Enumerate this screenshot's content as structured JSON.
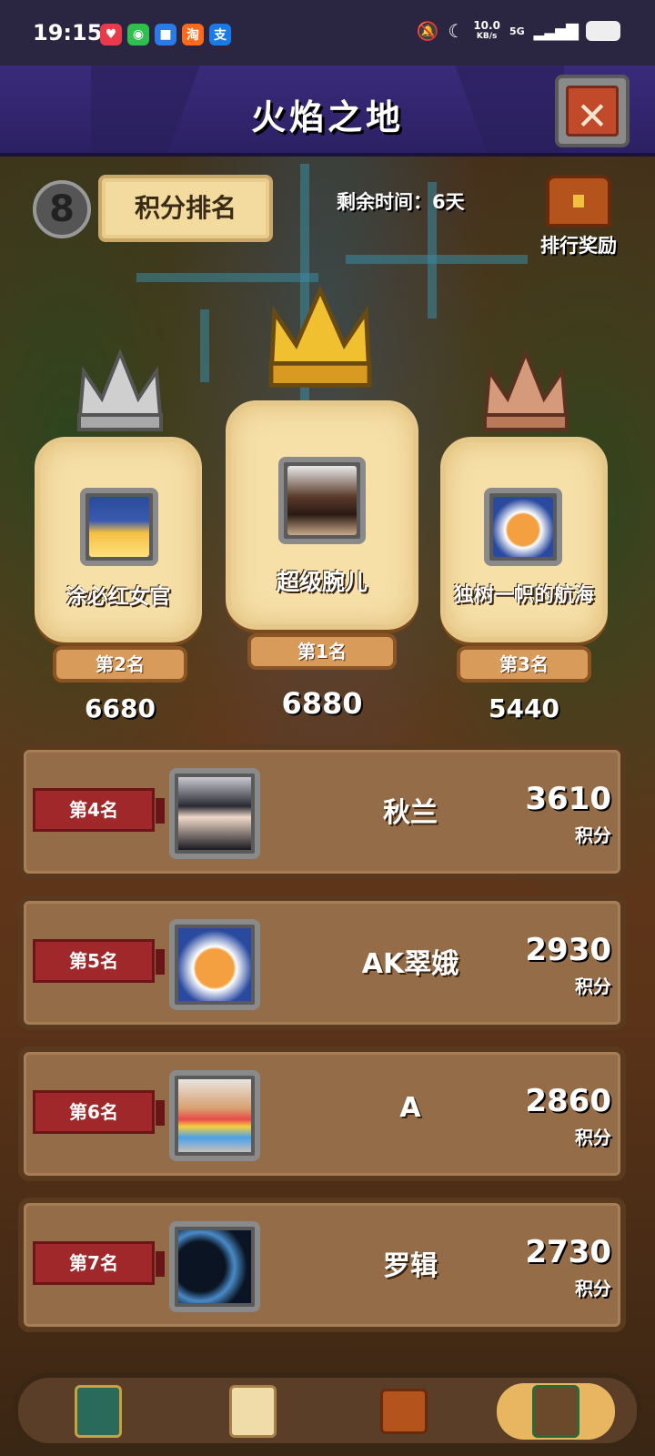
{
  "status_bar": {
    "time": "19:15",
    "speed_value": "10.0",
    "speed_unit": "KB/s",
    "network": "5G"
  },
  "header": {
    "title": "火焰之地",
    "close_icon": "close-icon"
  },
  "info": {
    "round": "8",
    "ranking_label": "积分排名",
    "remaining_time": "剩余时间：6天",
    "reward_label": "排行奖励"
  },
  "podium": {
    "first": {
      "name": "超级腕儿",
      "rank": "第1名",
      "score": "6880",
      "crown_color": "#e8b830"
    },
    "second": {
      "name": "涂必红女官",
      "rank": "第2名",
      "score": "6680",
      "crown_color": "#c8c8c8"
    },
    "third": {
      "name": "独树一帜的航海",
      "rank": "第3名",
      "score": "5440",
      "crown_color": "#c88a6a"
    }
  },
  "ranking_list": [
    {
      "rank": "第4名",
      "name": "秋兰",
      "score": "3610",
      "unit": "积分"
    },
    {
      "rank": "第5名",
      "name": "AK翠娥",
      "score": "2930",
      "unit": "积分"
    },
    {
      "rank": "第6名",
      "name": "A",
      "score": "2860",
      "unit": "积分"
    },
    {
      "rank": "第7名",
      "name": "罗辑",
      "score": "2730",
      "unit": "积分"
    }
  ],
  "bottom_nav": [
    {
      "icon": "card-icon"
    },
    {
      "icon": "task-scroll-icon"
    },
    {
      "icon": "treasure-chest-icon"
    },
    {
      "icon": "ranking-board-icon"
    }
  ]
}
